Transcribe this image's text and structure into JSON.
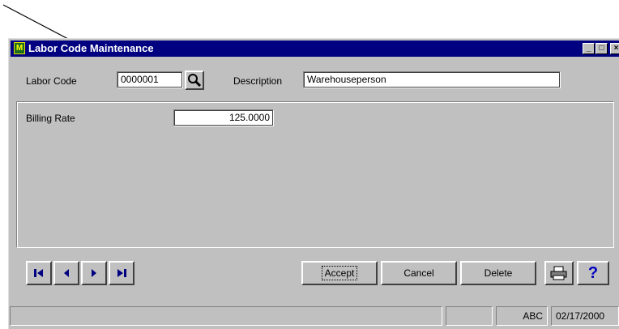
{
  "window": {
    "title": "Labor Code Maintenance"
  },
  "form": {
    "labor_code_label": "Labor Code",
    "labor_code_value": "0000001",
    "description_label": "Description",
    "description_value": "Warehouseperson",
    "billing_rate_label": "Billing Rate",
    "billing_rate_value": "125.0000"
  },
  "buttons": {
    "accept": "Accept",
    "cancel": "Cancel",
    "delete": "Delete",
    "help": "?"
  },
  "statusbar": {
    "user": "ABC",
    "date": "02/17/2000"
  },
  "icons": [
    "app-icon",
    "search-icon",
    "first-record-icon",
    "previous-record-icon",
    "next-record-icon",
    "last-record-icon",
    "printer-icon",
    "help-icon"
  ]
}
